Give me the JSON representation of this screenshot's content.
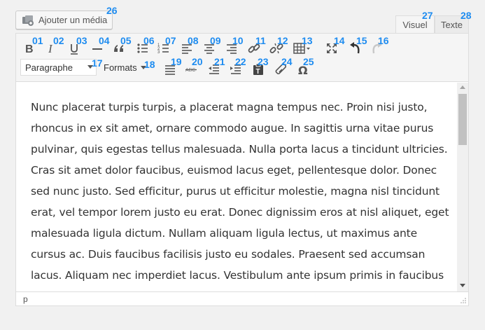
{
  "media_button": {
    "label": "Ajouter un média",
    "marker": "26"
  },
  "tabs": [
    {
      "label": "Visuel",
      "marker": "27"
    },
    {
      "label": "Texte",
      "marker": "28"
    }
  ],
  "toolbar_row1": [
    {
      "marker": "01",
      "icon": "bold-icon"
    },
    {
      "marker": "02",
      "icon": "italic-icon"
    },
    {
      "marker": "03",
      "icon": "underline-icon"
    },
    {
      "marker": "04",
      "icon": "horizontal-line-icon"
    },
    {
      "marker": "05",
      "icon": "blockquote-icon"
    },
    {
      "marker": "06",
      "icon": "bullet-list-icon"
    },
    {
      "marker": "07",
      "icon": "numbered-list-icon"
    },
    {
      "marker": "08",
      "icon": "align-left-icon"
    },
    {
      "marker": "09",
      "icon": "align-center-icon"
    },
    {
      "marker": "10",
      "icon": "align-right-icon"
    },
    {
      "marker": "11",
      "icon": "insert-link-icon"
    },
    {
      "marker": "12",
      "icon": "remove-link-icon"
    },
    {
      "marker": "13",
      "icon": "table-icon"
    },
    {
      "marker": "14",
      "icon": "fullscreen-icon"
    },
    {
      "marker": "15",
      "icon": "undo-icon"
    },
    {
      "marker": "16",
      "icon": "redo-icon"
    }
  ],
  "toolbar_row2": {
    "paragraph_select": {
      "value": "Paragraphe",
      "marker": "17"
    },
    "formats_menu": {
      "label": "Formats",
      "marker": "18"
    },
    "buttons": [
      {
        "marker": "19",
        "icon": "justify-icon"
      },
      {
        "marker": "20",
        "icon": "strikethrough-icon"
      },
      {
        "marker": "21",
        "icon": "outdent-icon"
      },
      {
        "marker": "22",
        "icon": "indent-icon"
      },
      {
        "marker": "23",
        "icon": "paste-text-icon"
      },
      {
        "marker": "24",
        "icon": "clear-formatting-icon"
      },
      {
        "marker": "25",
        "icon": "special-character-icon"
      }
    ]
  },
  "content": {
    "text": "Nunc placerat turpis turpis, a placerat magna tempus nec. Proin nisi justo, rhoncus in ex sit amet, ornare commodo augue. In sagittis urna vitae purus pulvinar, quis egestas tellus malesuada. Nulla porta lacus a tincidunt ultricies. Cras sit amet dolor faucibus, euismod lacus eget, pellentesque dolor. Donec sed nunc justo. Sed efficitur, purus ut efficitur molestie, magna nisl tincidunt erat, vel tempor lorem justo eu erat. Donec dignissim eros at nisl aliquet, eget malesuada ligula dictum. Nullam aliquam ligula lectus, ut maximus ante cursus ac. Duis faucibus facilisis justo eu sodales. Praesent sed accumsan lacus. Aliquam nec imperdiet lacus. Vestibulum ante ipsum primis in faucibus orci luctus et ultrices posuere cubilia curae."
  },
  "status_bar": {
    "path": "p"
  },
  "colors": {
    "marker": "#1e8cf0",
    "toolbar_bg": "#f5f5f5",
    "border": "#dddddd",
    "text": "#333333"
  }
}
